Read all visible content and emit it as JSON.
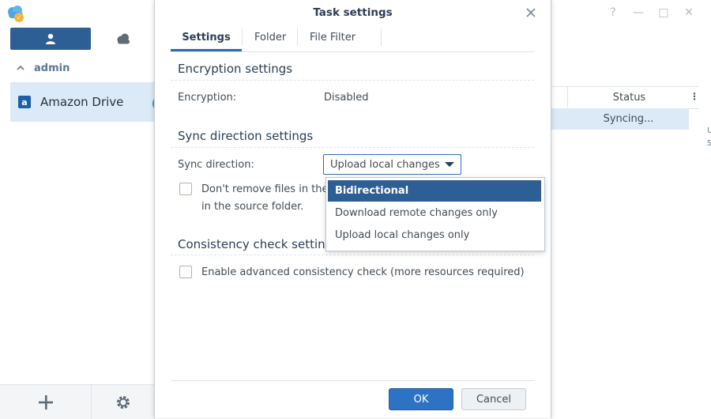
{
  "app": {
    "connection_name": "Amazon Drive",
    "user_group": "admin",
    "window_controls": [
      "?",
      "—",
      "□",
      "✕"
    ],
    "table": {
      "status_header": "Status",
      "rows": [
        {
          "status": "Syncing..."
        }
      ]
    },
    "right_fragments": [
      "u",
      "s"
    ]
  },
  "modal": {
    "title": "Task settings",
    "tabs": [
      "Settings",
      "Folder",
      "File Filter"
    ],
    "active_tab": "Settings",
    "encryption": {
      "section_title": "Encryption settings",
      "label": "Encryption:",
      "value": "Disabled"
    },
    "sync": {
      "section_title": "Sync direction settings",
      "label": "Sync direction:",
      "selected_value": "Upload local changes o",
      "dont_remove_line1": "Don't remove files in the c",
      "dont_remove_line2": "in the source folder.",
      "options": [
        "Bidirectional",
        "Download remote changes only",
        "Upload local changes only"
      ],
      "highlighted_option": "Bidirectional"
    },
    "consistency": {
      "section_title": "Consistency check settin",
      "checkbox_label": "Enable advanced consistency check (more resources required)"
    },
    "buttons": {
      "ok": "OK",
      "cancel": "Cancel"
    }
  },
  "colors": {
    "accent": "#2e72c3",
    "selection": "#2d5e94",
    "highlight_row": "#dce9f7"
  }
}
